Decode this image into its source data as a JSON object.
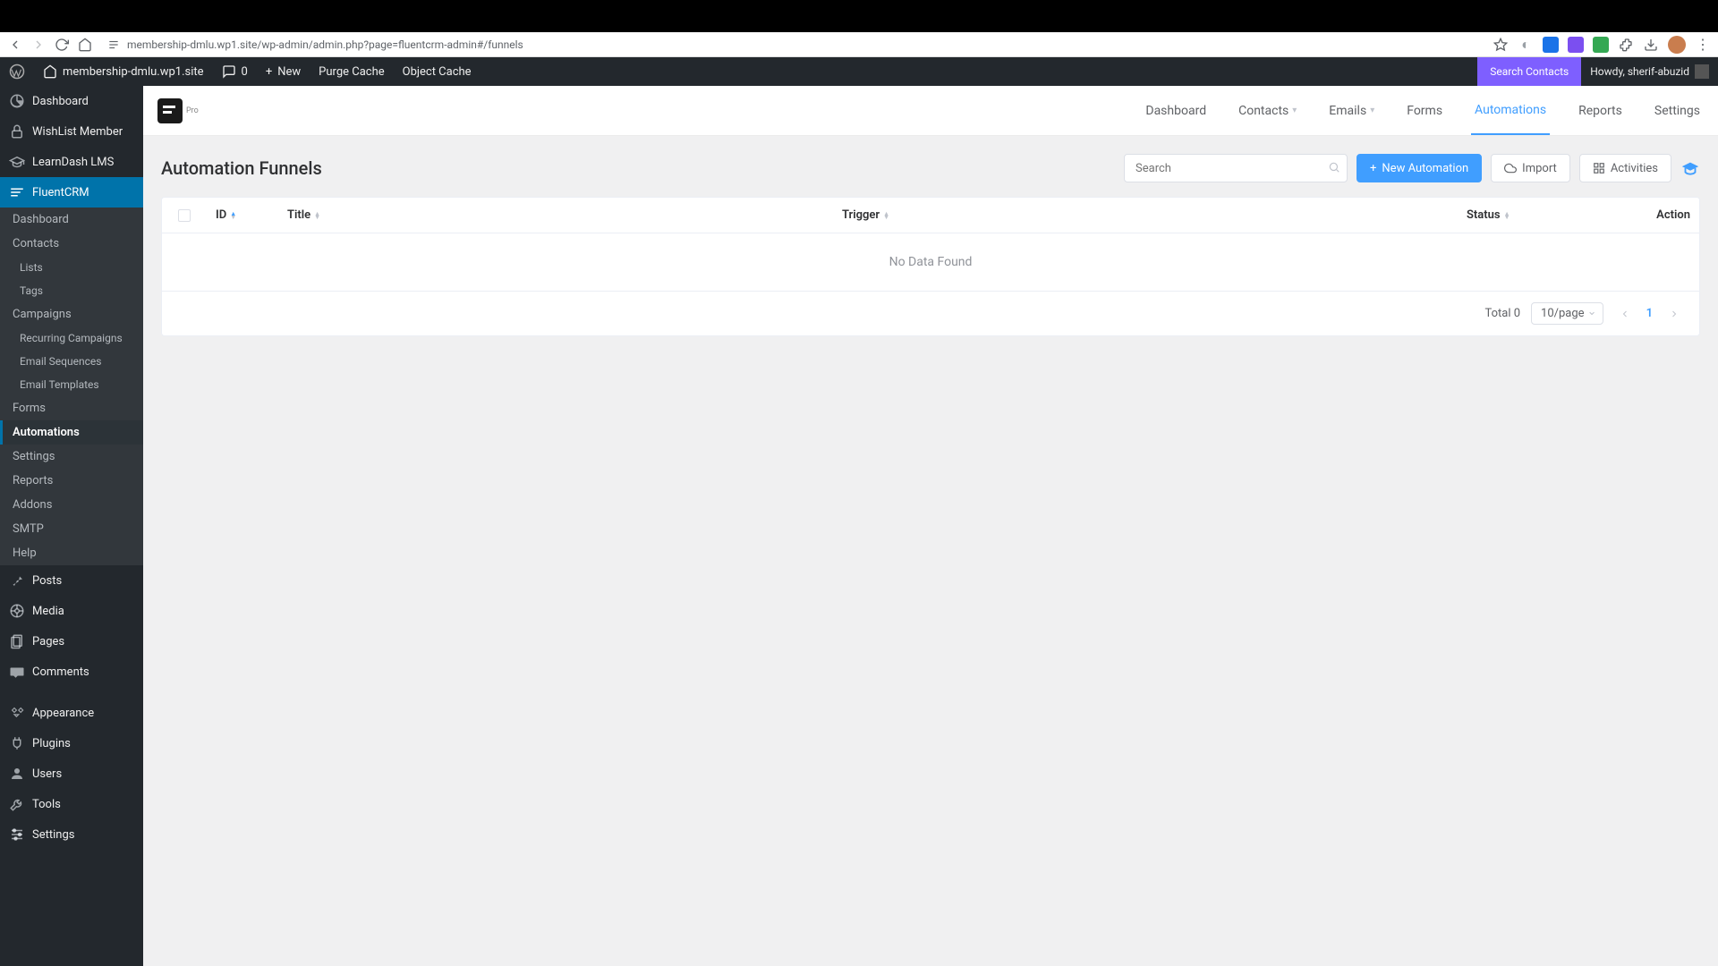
{
  "browser": {
    "url": "membership-dmlu.wp1.site/wp-admin/admin.php?page=fluentcrm-admin#/funnels"
  },
  "wp_admin_bar": {
    "site_name": "membership-dmlu.wp1.site",
    "comments_count": "0",
    "new_label": "New",
    "purge_cache": "Purge Cache",
    "object_cache": "Object Cache",
    "search_contacts": "Search Contacts",
    "howdy": "Howdy, sherif-abuzid"
  },
  "wp_sidebar": {
    "items": [
      {
        "label": "Dashboard",
        "icon": "dashboard-icon"
      },
      {
        "label": "WishList Member",
        "icon": "lock-icon"
      },
      {
        "label": "LearnDash LMS",
        "icon": "book-icon"
      },
      {
        "label": "FluentCRM",
        "icon": "crm-icon"
      }
    ],
    "fluent_submenu": {
      "dashboard": "Dashboard",
      "contacts": "Contacts",
      "lists": "Lists",
      "tags": "Tags",
      "campaigns": "Campaigns",
      "recurring": "Recurring Campaigns",
      "sequences": "Email Sequences",
      "templates": "Email Templates",
      "forms": "Forms",
      "automations": "Automations",
      "settings": "Settings",
      "reports": "Reports",
      "addons": "Addons",
      "smtp": "SMTP",
      "help": "Help"
    },
    "lower_items": [
      {
        "label": "Posts",
        "icon": "pin-icon"
      },
      {
        "label": "Media",
        "icon": "media-icon"
      },
      {
        "label": "Pages",
        "icon": "pages-icon"
      },
      {
        "label": "Comments",
        "icon": "comments-icon"
      },
      {
        "label": "Appearance",
        "icon": "appearance-icon"
      },
      {
        "label": "Plugins",
        "icon": "plugins-icon"
      },
      {
        "label": "Users",
        "icon": "users-icon"
      },
      {
        "label": "Tools",
        "icon": "tools-icon"
      },
      {
        "label": "Settings",
        "icon": "settings-icon"
      }
    ]
  },
  "fc_nav": {
    "pro_badge": "Pro",
    "items": [
      "Dashboard",
      "Contacts",
      "Emails",
      "Forms",
      "Automations",
      "Reports",
      "Settings"
    ]
  },
  "page": {
    "title": "Automation Funnels",
    "search_placeholder": "Search",
    "new_button": "New Automation",
    "import_button": "Import",
    "activities_button": "Activities"
  },
  "table": {
    "headers": {
      "id": "ID",
      "title": "Title",
      "trigger": "Trigger",
      "status": "Status",
      "action": "Action"
    },
    "no_data": "No Data Found"
  },
  "pagination": {
    "total_label": "Total 0",
    "page_size": "10/page",
    "current_page": "1"
  }
}
